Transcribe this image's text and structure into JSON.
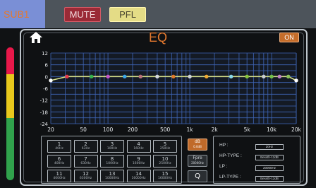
{
  "header": {
    "channel": "SUB1",
    "mute_label": "MUTE",
    "pfl_label": "PFL"
  },
  "eq": {
    "title": "EQ",
    "on_label": "ON",
    "y_ticks": [
      "12",
      "6",
      "0",
      "-6",
      "-12",
      "-18",
      "-24"
    ],
    "x_ticks": [
      "20",
      "50",
      "100",
      "200",
      "500",
      "1k",
      "2k",
      "5k",
      "10k",
      "20k"
    ]
  },
  "chart_data": {
    "type": "line",
    "ylim": [
      -24,
      12
    ],
    "xlim": [
      20,
      20000
    ],
    "x_scale": "log",
    "grid": true,
    "curve_color": "#d6e08a",
    "points": [
      {
        "x": 20,
        "y": -2,
        "color": "#ffffff"
      },
      {
        "x": 31.5,
        "y": 0,
        "color": "#e83a4a"
      },
      {
        "x": 63,
        "y": 0,
        "color": "#33b24a"
      },
      {
        "x": 100,
        "y": 0,
        "color": "#c254c8"
      },
      {
        "x": 160,
        "y": 0,
        "color": "#3aa6e8"
      },
      {
        "x": 250,
        "y": 0,
        "color": "#b8707a"
      },
      {
        "x": 400,
        "y": 0,
        "color": "#d4d8dc"
      },
      {
        "x": 630,
        "y": 0,
        "color": "#e07a2a"
      },
      {
        "x": 1000,
        "y": 0,
        "color": "#ccd0d4"
      },
      {
        "x": 1600,
        "y": 0,
        "color": "#f0a830"
      },
      {
        "x": 3200,
        "y": 0,
        "color": "#8ad8e8"
      },
      {
        "x": 5000,
        "y": 0,
        "color": "#86c43a"
      },
      {
        "x": 8000,
        "y": 0,
        "color": "#c8ccd0"
      },
      {
        "x": 10000,
        "y": 0,
        "color": "#74c04a"
      },
      {
        "x": 12500,
        "y": 0,
        "color": "#c080c8"
      },
      {
        "x": 16000,
        "y": 0,
        "color": "#8ac05a"
      },
      {
        "x": 20000,
        "y": -2,
        "color": "#ffffff"
      }
    ]
  },
  "bands": [
    {
      "num": "1",
      "freq": "40Hz"
    },
    {
      "num": "2",
      "freq": "63Hz"
    },
    {
      "num": "3",
      "freq": "100Hz"
    },
    {
      "num": "4",
      "freq": "160Hz"
    },
    {
      "num": "5",
      "freq": "250Hz"
    },
    {
      "num": "6",
      "freq": "400Hz"
    },
    {
      "num": "7",
      "freq": "630Hz"
    },
    {
      "num": "8",
      "freq": "1000Hz"
    },
    {
      "num": "9",
      "freq": "1600Hz"
    },
    {
      "num": "10",
      "freq": "2500Hz"
    },
    {
      "num": "11",
      "freq": "4000Hz"
    },
    {
      "num": "12",
      "freq": "6300Hz"
    },
    {
      "num": "13",
      "freq": "10000Hz"
    },
    {
      "num": "14",
      "freq": "16000Hz"
    },
    {
      "num": "15",
      "freq": "16000Hz"
    }
  ],
  "tools": {
    "db_label": "dB",
    "db_value": "0.0dB",
    "fpre_label": "Fpre",
    "fpre_value": "20000Hz",
    "q_label": "Q"
  },
  "filters": {
    "hp_label": "HP :",
    "hp_value": "20Hz",
    "hp_type_label": "HP-TYPE :",
    "hp_type_value": "Bessth-12dB",
    "lp_label": "LP :",
    "lp_value": "20000Hz",
    "lp_type_label": "LP-TYPE :",
    "lp_type_value": "Bessth-12dB"
  },
  "colors": {
    "accent_orange": "#e4792e",
    "mute": "#9a2a36",
    "pfl": "#e4dc86",
    "grid_blue": "#3f66b8"
  }
}
